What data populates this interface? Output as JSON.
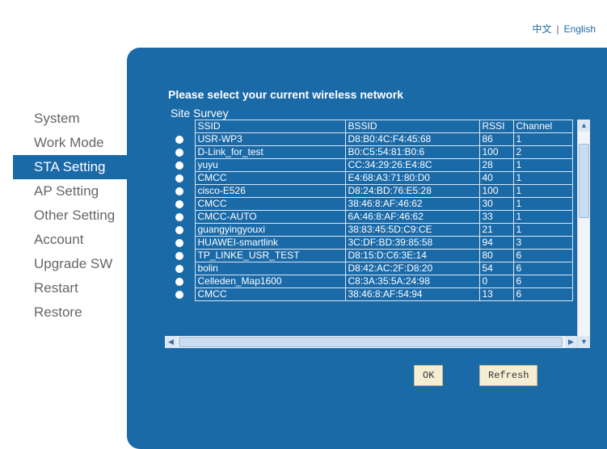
{
  "lang": {
    "chinese": "中文",
    "separator": "|",
    "english": "English"
  },
  "menu": [
    {
      "label": "System"
    },
    {
      "label": "Work Mode"
    },
    {
      "label": "STA Setting"
    },
    {
      "label": "AP Setting"
    },
    {
      "label": "Other Setting"
    },
    {
      "label": "Account"
    },
    {
      "label": "Upgrade SW"
    },
    {
      "label": "Restart"
    },
    {
      "label": "Restore"
    }
  ],
  "active_menu": "STA Setting",
  "panel": {
    "heading": "Please select your current wireless network",
    "survey_label": "Site Survey"
  },
  "table": {
    "headers": [
      "SSID",
      "BSSID",
      "RSSI",
      "Channel"
    ],
    "rows": [
      [
        "USR-WP3",
        "D8:B0:4C:F4:45:68",
        "86",
        "1"
      ],
      [
        "D-Link_for_test",
        "B0:C5:54:81:B0:6",
        "100",
        "2"
      ],
      [
        "yuyu",
        "CC:34:29:26:E4:8C",
        "28",
        "1"
      ],
      [
        "CMCC",
        "E4:68:A3:71:80:D0",
        "40",
        "1"
      ],
      [
        "cisco-E526",
        "D8:24:BD:76:E5:28",
        "100",
        "1"
      ],
      [
        "CMCC",
        "38:46:8:AF:46:62",
        "30",
        "1"
      ],
      [
        "CMCC-AUTO",
        "6A:46:8:AF:46:62",
        "33",
        "1"
      ],
      [
        "guangyingyouxi",
        "38:83:45:5D:C9:CE",
        "21",
        "1"
      ],
      [
        "HUAWEI-smartlink",
        "3C:DF:BD:39:85:58",
        "94",
        "3"
      ],
      [
        "TP_LINKE_USR_TEST",
        "D8:15:D:C6:3E:14",
        "80",
        "6"
      ],
      [
        "bolin",
        "D8:42:AC:2F:D8:20",
        "54",
        "6"
      ],
      [
        "Celleden_Map1600",
        "C8:3A:35:5A:24:98",
        "0",
        "6"
      ],
      [
        "CMCC",
        "38:46:8:AF:54:94",
        "13",
        "6"
      ]
    ]
  },
  "buttons": {
    "ok": "OK",
    "refresh": "Refresh"
  },
  "colors": {
    "brand_blue": "#1b6aa8",
    "button_bg": "#f6edd5"
  }
}
